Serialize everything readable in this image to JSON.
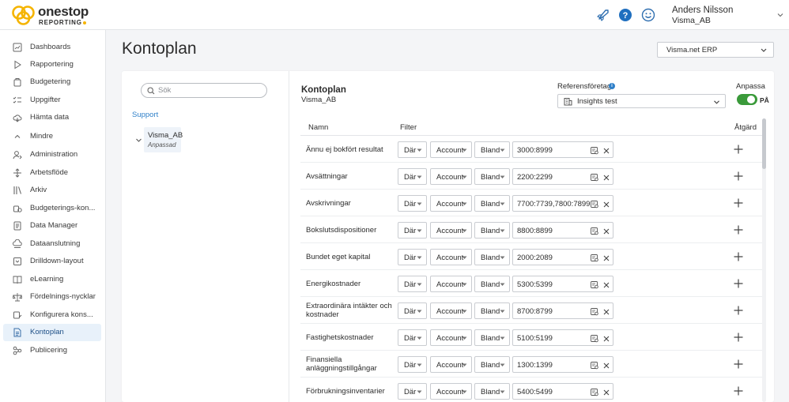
{
  "app": {
    "logo_main": "onestop",
    "logo_sub": "REPORTING",
    "colors": {
      "logo_yellow": "#f5b400",
      "accent_blue": "#2f80c9",
      "toggle_green": "#3a9a3a",
      "active_nav": "#e8f1fa"
    }
  },
  "topbar": {
    "icons": [
      "rocket-icon",
      "help-icon",
      "smiley-icon"
    ],
    "user_name": "Anders Nilsson",
    "user_org": "Visma_AB"
  },
  "sidebar": {
    "items": [
      {
        "label": "Dashboards",
        "icon": "dashboard-icon"
      },
      {
        "label": "Rapportering",
        "icon": "play-icon"
      },
      {
        "label": "Budgetering",
        "icon": "budget-icon"
      },
      {
        "label": "Uppgifter",
        "icon": "tasks-icon"
      },
      {
        "label": "Hämta data",
        "icon": "cloud-icon"
      },
      {
        "label": "Mindre",
        "icon": "chevron-up-icon"
      },
      {
        "label": "Administration",
        "icon": "admin-icon"
      },
      {
        "label": "Arbetsflöde",
        "icon": "workflow-icon"
      },
      {
        "label": "Arkiv",
        "icon": "archive-icon"
      },
      {
        "label": "Budgeterings-kon...",
        "icon": "budget-config-icon"
      },
      {
        "label": "Data Manager",
        "icon": "data-manager-icon"
      },
      {
        "label": "Dataanslutning",
        "icon": "data-connection-icon"
      },
      {
        "label": "Drilldown-layout",
        "icon": "drilldown-icon"
      },
      {
        "label": "eLearning",
        "icon": "book-icon"
      },
      {
        "label": "Fördelnings-nycklar",
        "icon": "scale-icon"
      },
      {
        "label": "Konfigurera kons...",
        "icon": "configure-icon"
      },
      {
        "label": "Kontoplan",
        "icon": "document-icon",
        "active": true
      },
      {
        "label": "Publicering",
        "icon": "publish-icon"
      }
    ]
  },
  "header": {
    "title": "Kontoplan",
    "erp_select": "Visma.net ERP"
  },
  "left_panel": {
    "search_placeholder": "Sök",
    "support_link": "Support",
    "tree_node": {
      "name": "Visma_AB",
      "status": "Anpassad"
    }
  },
  "right_panel": {
    "title": "Kontoplan",
    "subtitle": "Visma_AB",
    "reference_label": "Referensföretag",
    "reference_value": "Insights test",
    "customize_label": "Anpassa",
    "toggle_text": "PÅ",
    "columns": {
      "name": "Namn",
      "filter": "Filter",
      "action": "Åtgärd"
    },
    "rows": [
      {
        "name": "Ännu ej bokfört resultat",
        "where": "Där",
        "field": "Account",
        "op": "Bland",
        "value": "3000:8999"
      },
      {
        "name": "Avsättningar",
        "where": "Där",
        "field": "Account",
        "op": "Bland",
        "value": "2200:2299"
      },
      {
        "name": "Avskrivningar",
        "where": "Där",
        "field": "Account",
        "op": "Bland",
        "value": "7700:7739,7800:7899"
      },
      {
        "name": "Bokslutsdispositioner",
        "where": "Där",
        "field": "Account",
        "op": "Bland",
        "value": "8800:8899"
      },
      {
        "name": "Bundet eget kapital",
        "where": "Där",
        "field": "Account",
        "op": "Bland",
        "value": "2000:2089"
      },
      {
        "name": "Energikostnader",
        "where": "Där",
        "field": "Account",
        "op": "Bland",
        "value": "5300:5399"
      },
      {
        "name": "Extraordinära intäkter och kostnader",
        "where": "Där",
        "field": "Account",
        "op": "Bland",
        "value": "8700:8799"
      },
      {
        "name": "Fastighetskostnader",
        "where": "Där",
        "field": "Account",
        "op": "Bland",
        "value": "5100:5199"
      },
      {
        "name": "Finansiella anläggningstillgångar",
        "where": "Där",
        "field": "Account",
        "op": "Bland",
        "value": "1300:1399"
      },
      {
        "name": "Förbrukningsinventarier",
        "where": "Där",
        "field": "Account",
        "op": "Bland",
        "value": "5400:5499"
      }
    ]
  }
}
